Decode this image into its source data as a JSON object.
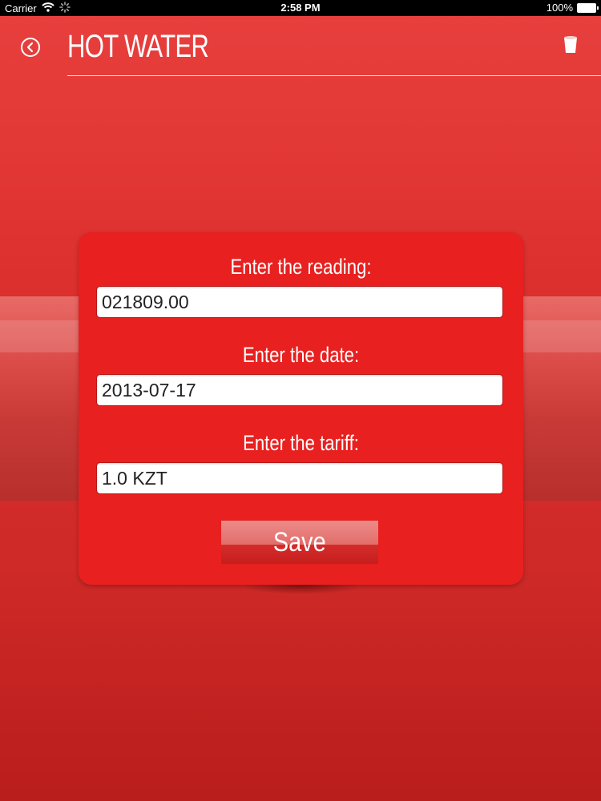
{
  "status_bar": {
    "carrier": "Carrier",
    "time": "2:58 PM",
    "battery": "100%"
  },
  "header": {
    "title": "HOT WATER"
  },
  "form": {
    "reading_label": "Enter the reading:",
    "reading_value": "021809.00",
    "date_label": "Enter the date:",
    "date_value": "2013-07-17",
    "tariff_label": "Enter the tariff:",
    "tariff_value": "1.0 KZT",
    "save_label": "Save"
  },
  "icons": {
    "back": "back-arrow-icon",
    "trash": "trash-icon",
    "wifi": "wifi-icon",
    "activity": "spinner-icon",
    "battery": "battery-icon"
  },
  "colors": {
    "background": "#dc302e",
    "card": "#e8201f",
    "text": "#ffffff"
  }
}
